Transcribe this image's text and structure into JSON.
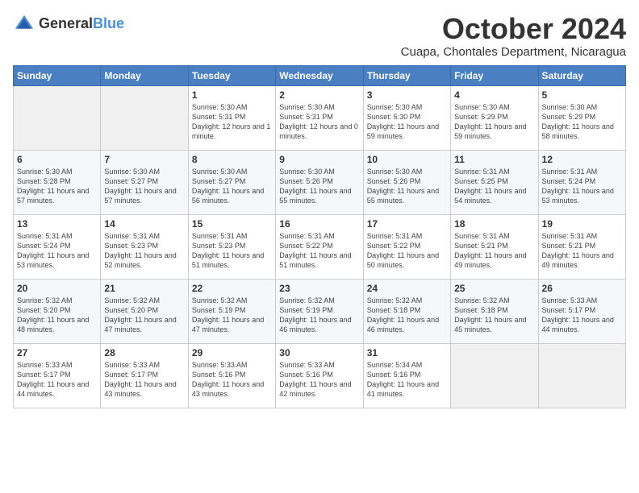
{
  "logo": {
    "general": "General",
    "blue": "Blue"
  },
  "title": "October 2024",
  "subtitle": "Cuapa, Chontales Department, Nicaragua",
  "days_of_week": [
    "Sunday",
    "Monday",
    "Tuesday",
    "Wednesday",
    "Thursday",
    "Friday",
    "Saturday"
  ],
  "weeks": [
    [
      {
        "day": "",
        "info": ""
      },
      {
        "day": "",
        "info": ""
      },
      {
        "day": "1",
        "info": "Sunrise: 5:30 AM\nSunset: 5:31 PM\nDaylight: 12 hours and 1 minute."
      },
      {
        "day": "2",
        "info": "Sunrise: 5:30 AM\nSunset: 5:31 PM\nDaylight: 12 hours and 0 minutes."
      },
      {
        "day": "3",
        "info": "Sunrise: 5:30 AM\nSunset: 5:30 PM\nDaylight: 11 hours and 59 minutes."
      },
      {
        "day": "4",
        "info": "Sunrise: 5:30 AM\nSunset: 5:29 PM\nDaylight: 11 hours and 59 minutes."
      },
      {
        "day": "5",
        "info": "Sunrise: 5:30 AM\nSunset: 5:29 PM\nDaylight: 11 hours and 58 minutes."
      }
    ],
    [
      {
        "day": "6",
        "info": "Sunrise: 5:30 AM\nSunset: 5:28 PM\nDaylight: 11 hours and 57 minutes."
      },
      {
        "day": "7",
        "info": "Sunrise: 5:30 AM\nSunset: 5:27 PM\nDaylight: 11 hours and 57 minutes."
      },
      {
        "day": "8",
        "info": "Sunrise: 5:30 AM\nSunset: 5:27 PM\nDaylight: 11 hours and 56 minutes."
      },
      {
        "day": "9",
        "info": "Sunrise: 5:30 AM\nSunset: 5:26 PM\nDaylight: 11 hours and 55 minutes."
      },
      {
        "day": "10",
        "info": "Sunrise: 5:30 AM\nSunset: 5:26 PM\nDaylight: 11 hours and 55 minutes."
      },
      {
        "day": "11",
        "info": "Sunrise: 5:31 AM\nSunset: 5:25 PM\nDaylight: 11 hours and 54 minutes."
      },
      {
        "day": "12",
        "info": "Sunrise: 5:31 AM\nSunset: 5:24 PM\nDaylight: 11 hours and 53 minutes."
      }
    ],
    [
      {
        "day": "13",
        "info": "Sunrise: 5:31 AM\nSunset: 5:24 PM\nDaylight: 11 hours and 53 minutes."
      },
      {
        "day": "14",
        "info": "Sunrise: 5:31 AM\nSunset: 5:23 PM\nDaylight: 11 hours and 52 minutes."
      },
      {
        "day": "15",
        "info": "Sunrise: 5:31 AM\nSunset: 5:23 PM\nDaylight: 11 hours and 51 minutes."
      },
      {
        "day": "16",
        "info": "Sunrise: 5:31 AM\nSunset: 5:22 PM\nDaylight: 11 hours and 51 minutes."
      },
      {
        "day": "17",
        "info": "Sunrise: 5:31 AM\nSunset: 5:22 PM\nDaylight: 11 hours and 50 minutes."
      },
      {
        "day": "18",
        "info": "Sunrise: 5:31 AM\nSunset: 5:21 PM\nDaylight: 11 hours and 49 minutes."
      },
      {
        "day": "19",
        "info": "Sunrise: 5:31 AM\nSunset: 5:21 PM\nDaylight: 11 hours and 49 minutes."
      }
    ],
    [
      {
        "day": "20",
        "info": "Sunrise: 5:32 AM\nSunset: 5:20 PM\nDaylight: 11 hours and 48 minutes."
      },
      {
        "day": "21",
        "info": "Sunrise: 5:32 AM\nSunset: 5:20 PM\nDaylight: 11 hours and 47 minutes."
      },
      {
        "day": "22",
        "info": "Sunrise: 5:32 AM\nSunset: 5:19 PM\nDaylight: 11 hours and 47 minutes."
      },
      {
        "day": "23",
        "info": "Sunrise: 5:32 AM\nSunset: 5:19 PM\nDaylight: 11 hours and 46 minutes."
      },
      {
        "day": "24",
        "info": "Sunrise: 5:32 AM\nSunset: 5:18 PM\nDaylight: 11 hours and 46 minutes."
      },
      {
        "day": "25",
        "info": "Sunrise: 5:32 AM\nSunset: 5:18 PM\nDaylight: 11 hours and 45 minutes."
      },
      {
        "day": "26",
        "info": "Sunrise: 5:33 AM\nSunset: 5:17 PM\nDaylight: 11 hours and 44 minutes."
      }
    ],
    [
      {
        "day": "27",
        "info": "Sunrise: 5:33 AM\nSunset: 5:17 PM\nDaylight: 11 hours and 44 minutes."
      },
      {
        "day": "28",
        "info": "Sunrise: 5:33 AM\nSunset: 5:17 PM\nDaylight: 11 hours and 43 minutes."
      },
      {
        "day": "29",
        "info": "Sunrise: 5:33 AM\nSunset: 5:16 PM\nDaylight: 11 hours and 43 minutes."
      },
      {
        "day": "30",
        "info": "Sunrise: 5:33 AM\nSunset: 5:16 PM\nDaylight: 11 hours and 42 minutes."
      },
      {
        "day": "31",
        "info": "Sunrise: 5:34 AM\nSunset: 5:16 PM\nDaylight: 11 hours and 41 minutes."
      },
      {
        "day": "",
        "info": ""
      },
      {
        "day": "",
        "info": ""
      }
    ]
  ]
}
